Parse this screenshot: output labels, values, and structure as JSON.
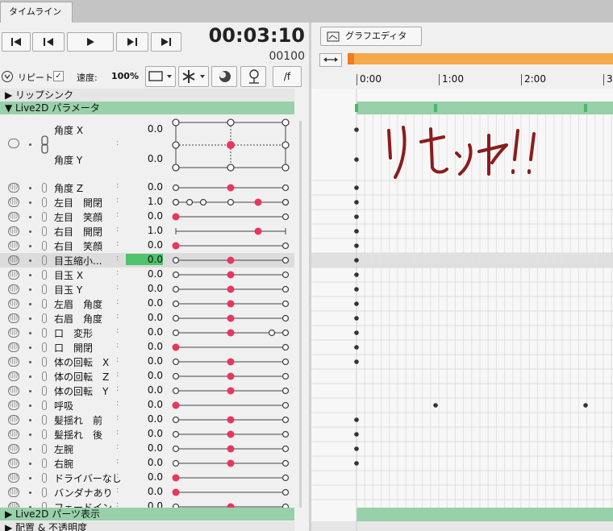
{
  "tab": {
    "label": "タイムライン"
  },
  "timecode": "00:03:10",
  "framecode": "00100",
  "options": {
    "repeat_label": "リピート",
    "speed_label": "速度:",
    "speed_value": "100%",
    "f_label": "/f"
  },
  "groups": {
    "lipsync": "▶ リップシンク",
    "live2d_params": "▼ Live2D パラメータ",
    "parts": "▶ Live2D パーツ表示",
    "bottom": "▶ 配置 & 不透明度"
  },
  "combined": {
    "row1": {
      "name": "角度 X",
      "value": "0.0"
    },
    "row2": {
      "name": "角度 Y",
      "value": "0.0"
    }
  },
  "params": [
    {
      "name": "角度 Z",
      "value": "0.0",
      "pos": 0.5,
      "type": "line"
    },
    {
      "name": "左目　開閉",
      "value": "1.0",
      "pos": 0.75,
      "type": "multi"
    },
    {
      "name": "左目　笑顔",
      "value": "0.0",
      "pos": 0.0,
      "type": "line"
    },
    {
      "name": "右目　開閉",
      "value": "1.0",
      "pos": 0.75,
      "type": "bar"
    },
    {
      "name": "右目　笑顔",
      "value": "0.0",
      "pos": 0.0,
      "type": "line"
    },
    {
      "name": "目玉縮小...",
      "value": "0.0",
      "pos": 0.5,
      "type": "line",
      "selected": true
    },
    {
      "name": "目玉 X",
      "value": "0.0",
      "pos": 0.5,
      "type": "line"
    },
    {
      "name": "目玉 Y",
      "value": "0.0",
      "pos": 0.5,
      "type": "line"
    },
    {
      "name": "左眉　角度",
      "value": "0.0",
      "pos": 0.5,
      "type": "line"
    },
    {
      "name": "右眉　角度",
      "value": "0.0",
      "pos": 0.5,
      "type": "line"
    },
    {
      "name": "口　変形",
      "value": "0.0",
      "pos": 0.5,
      "type": "mouth"
    },
    {
      "name": "口　開閉",
      "value": "0.0",
      "pos": 0.0,
      "type": "line"
    },
    {
      "name": "体の回転　X",
      "value": "0.0",
      "pos": 0.5,
      "type": "line"
    },
    {
      "name": "体の回転　Z",
      "value": "0.0",
      "pos": 0.5,
      "type": "line"
    },
    {
      "name": "体の回転　Y",
      "value": "0.0",
      "pos": 0.5,
      "type": "line"
    },
    {
      "name": "呼吸",
      "value": "0.0",
      "pos": 0.0,
      "type": "line"
    },
    {
      "name": "髪揺れ　前",
      "value": "0.0",
      "pos": 0.5,
      "type": "line"
    },
    {
      "name": "髪揺れ　後",
      "value": "0.0",
      "pos": 0.5,
      "type": "line"
    },
    {
      "name": "左腕",
      "value": "0.0",
      "pos": 0.5,
      "type": "line"
    },
    {
      "name": "右腕",
      "value": "0.0",
      "pos": 0.5,
      "type": "line"
    },
    {
      "name": "ドライバーなし",
      "value": "0.0",
      "pos": 0.0,
      "type": "line"
    },
    {
      "name": "バンダナあり",
      "value": "0.0",
      "pos": 0.0,
      "type": "line"
    },
    {
      "name": "フェードイン...",
      "value": "0.0",
      "pos": 0.5,
      "type": "line"
    }
  ],
  "graph_editor_label": "グラフエディタ",
  "ruler": [
    "0:00",
    "1:00",
    "2:00",
    "3"
  ],
  "annotation": "リセット!!",
  "colors": {
    "accent": "#e8365d",
    "group": "#97d0a9",
    "range": "#f4a94a"
  }
}
